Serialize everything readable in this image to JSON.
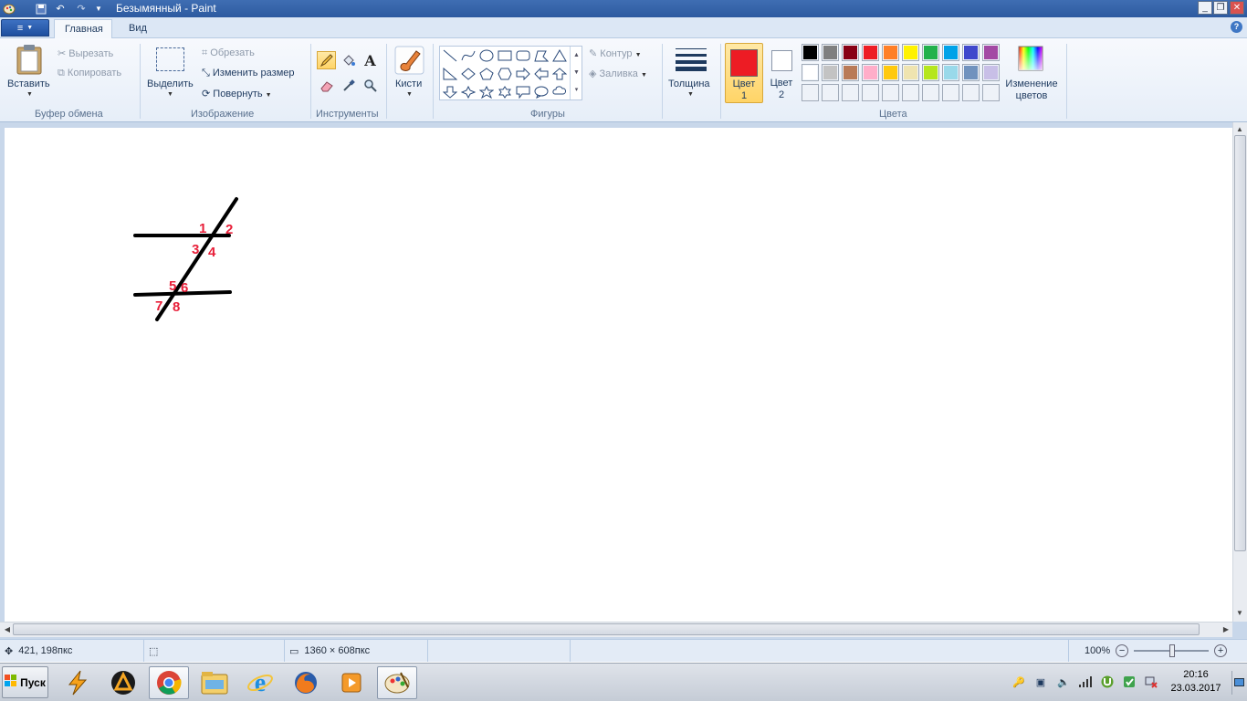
{
  "window": {
    "title": "Безымянный - Paint",
    "controls": {
      "minimize": "_",
      "restore": "❐",
      "close": "✕"
    }
  },
  "tabs": {
    "file": "≡",
    "home": "Главная",
    "view": "Вид"
  },
  "clipboard": {
    "paste": "Вставить",
    "cut": "Вырезать",
    "copy": "Копировать",
    "group": "Буфер обмена"
  },
  "image": {
    "select": "Выделить",
    "crop": "Обрезать",
    "resize": "Изменить размер",
    "rotate": "Повернуть",
    "group": "Изображение"
  },
  "tools": {
    "group": "Инструменты",
    "active": "pencil-icon",
    "text_glyph": "A"
  },
  "brushes": {
    "label": "Кисти"
  },
  "shapes": {
    "group": "Фигуры",
    "outline": "Контур",
    "fill": "Заливка"
  },
  "size": {
    "label": "Толщина"
  },
  "colors": {
    "color1_line1": "Цвет",
    "color1_line2": "1",
    "color2_line1": "Цвет",
    "color2_line2": "2",
    "color1": "#ed1c24",
    "color2": "#ffffff",
    "edit_line1": "Изменение",
    "edit_line2": "цветов",
    "group": "Цвета",
    "palette_row1": [
      "#000000",
      "#7f7f7f",
      "#880015",
      "#ed1c24",
      "#ff7f27",
      "#fff200",
      "#22b14c",
      "#00a2e8",
      "#3f48cc",
      "#a349a4"
    ],
    "palette_row2": [
      "#ffffff",
      "#c3c3c3",
      "#b97a57",
      "#ffaec9",
      "#ffc90e",
      "#efe4b0",
      "#b5e61d",
      "#99d9ea",
      "#7092be",
      "#c8bfe7"
    ]
  },
  "canvas": {
    "angle_labels": [
      "1",
      "2",
      "3",
      "4",
      "5",
      "6",
      "7",
      "8"
    ],
    "ink_color": "#000000",
    "label_color": "#e8203a"
  },
  "status": {
    "cursor_pos": "421, 198пкс",
    "image_size": "1360 × 608пкс",
    "zoom": "100%"
  },
  "taskbar": {
    "start": "Пуск",
    "time": "20:16",
    "date": "23.03.2017"
  }
}
